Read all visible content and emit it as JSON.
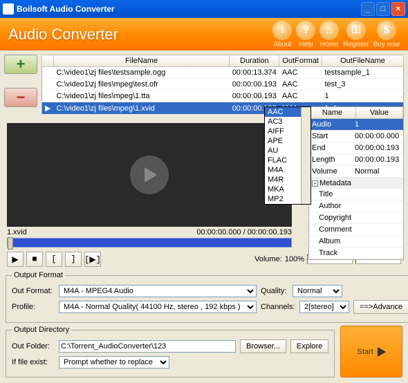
{
  "window": {
    "title": "Boilsoft Audio Converter"
  },
  "header": {
    "title": "Audio Converter",
    "buttons": [
      {
        "label": "About",
        "glyph": "i"
      },
      {
        "label": "Help",
        "glyph": "?"
      },
      {
        "label": "Home",
        "glyph": "⌂"
      },
      {
        "label": "Register",
        "glyph": "⚿"
      },
      {
        "label": "Buy now",
        "glyph": "$"
      }
    ]
  },
  "grid": {
    "cols": {
      "filename": "FileName",
      "duration": "Duration",
      "outformat": "OutFormat",
      "outfilename": "OutFileName"
    },
    "rows": [
      {
        "filename": "C:\\video1\\zj files\\testsample.ogg",
        "duration": "00:00:13.374",
        "outformat": "AAC",
        "outfilename": "testsample_1"
      },
      {
        "filename": "C:\\video1\\zj files\\mpeg\\test.ofr",
        "duration": "00:00:00.193",
        "outformat": "AAC",
        "outfilename": "test_3"
      },
      {
        "filename": "C:\\video1\\zj files\\mpeg\\1.tta",
        "duration": "00:00:00.193",
        "outformat": "AAC",
        "outfilename": "1"
      },
      {
        "filename": "C:\\video1\\zj files\\mpeg\\1.xvid",
        "duration": "00:00:00.193",
        "outformat": "M4A",
        "outfilename": "1_1"
      }
    ]
  },
  "dropdown": {
    "options": [
      "AAC",
      "AC3",
      "AIFF",
      "APE",
      "AU",
      "FLAC",
      "M4A",
      "M4R",
      "MKA",
      "MP2"
    ],
    "selected": "AAC"
  },
  "props": {
    "name": "Name",
    "value": "Value",
    "audio": {
      "k": "Audio",
      "v": "1"
    },
    "rows": [
      {
        "k": "Start",
        "v": "00:00:00.000"
      },
      {
        "k": "End",
        "v": "00:00:00.193"
      },
      {
        "k": "Length",
        "v": "00:00:00.193"
      },
      {
        "k": "Volume",
        "v": "Normal"
      }
    ],
    "meta_label": "Metadata",
    "meta_rows": [
      "Title",
      "Author",
      "Copyright",
      "Comment",
      "Album",
      "Track"
    ]
  },
  "video": {
    "name": "1.xvid",
    "time": "00:00:00.000 / 00:00:00.193"
  },
  "volume": {
    "label": "Volume:",
    "value": "100%"
  },
  "fmt": {
    "legend": "Output Format",
    "out_label": "Out Format:",
    "out_value": "M4A - MPEG4 Audio",
    "profile_label": "Profile:",
    "profile_value": "M4A - Normal Quality( 44100 Hz, stereo , 192 kbps )",
    "quality_label": "Quality:",
    "quality_value": "Normal",
    "channels_label": "Channels:",
    "channels_value": "2[stereo]",
    "advance": "==>Advance"
  },
  "dir": {
    "legend": "Output Directory",
    "folder_label": "Out Folder:",
    "folder_value": "C:\\Torrent_AudioConverter\\123",
    "browser": "Browser...",
    "explore": "Explore",
    "exist_label": "If file exist:",
    "exist_value": "Prompt whether to replace"
  },
  "start": "Start"
}
